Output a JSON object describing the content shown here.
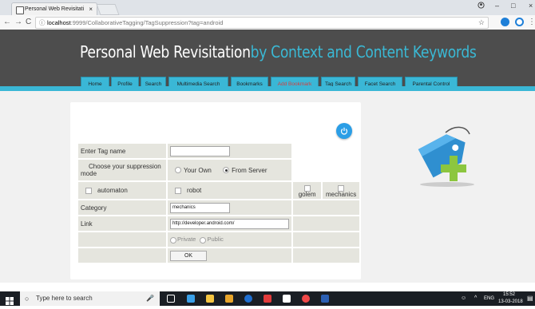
{
  "browser": {
    "tab_title": "Personal Web Revisitatio",
    "tab_close": "×",
    "url_host": "localhost",
    "url_path": ":9999/CollaborativeTagging/TagSuppression?tag=android",
    "back": "←",
    "forward": "→",
    "reload": "C",
    "info": "ⓘ",
    "star": "☆",
    "min": "–",
    "restore": "□",
    "close": "×"
  },
  "site": {
    "title_main": "Personal Web Revisitation",
    "title_accent": "by Context and Content Keywords"
  },
  "menu": [
    {
      "label": "Home"
    },
    {
      "label": "Profile"
    },
    {
      "label": "Search"
    },
    {
      "label": "Multimedia Search"
    },
    {
      "label": "Bookmarks"
    },
    {
      "label": "Add Bookmark"
    },
    {
      "label": "Tag Search"
    },
    {
      "label": "Facet Search"
    },
    {
      "label": "Parental Control"
    }
  ],
  "form": {
    "tag_label": "Enter Tag name",
    "tag_value": "",
    "suppression_label": "Choose your suppression mode",
    "option_own": "Your Own",
    "option_server": "From Server",
    "chk_automaton": "automaton",
    "chk_robot": "robot",
    "chk_golem": "golem",
    "chk_mechanics": "mechanics",
    "category_label": "Category",
    "category_value": "mechanics",
    "link_label": "Link",
    "link_value": "http://developer.android.com/",
    "private_label": "Private",
    "public_label": "Public",
    "ok_label": "OK"
  },
  "taskbar": {
    "search_placeholder": "Type here to search",
    "lang": "ENG",
    "time": "15:52",
    "date": "13-03-2018"
  },
  "colors": {
    "accent": "#3ab9d5",
    "header": "#4d4d4d",
    "active_menu_text": "#d63d3d"
  }
}
